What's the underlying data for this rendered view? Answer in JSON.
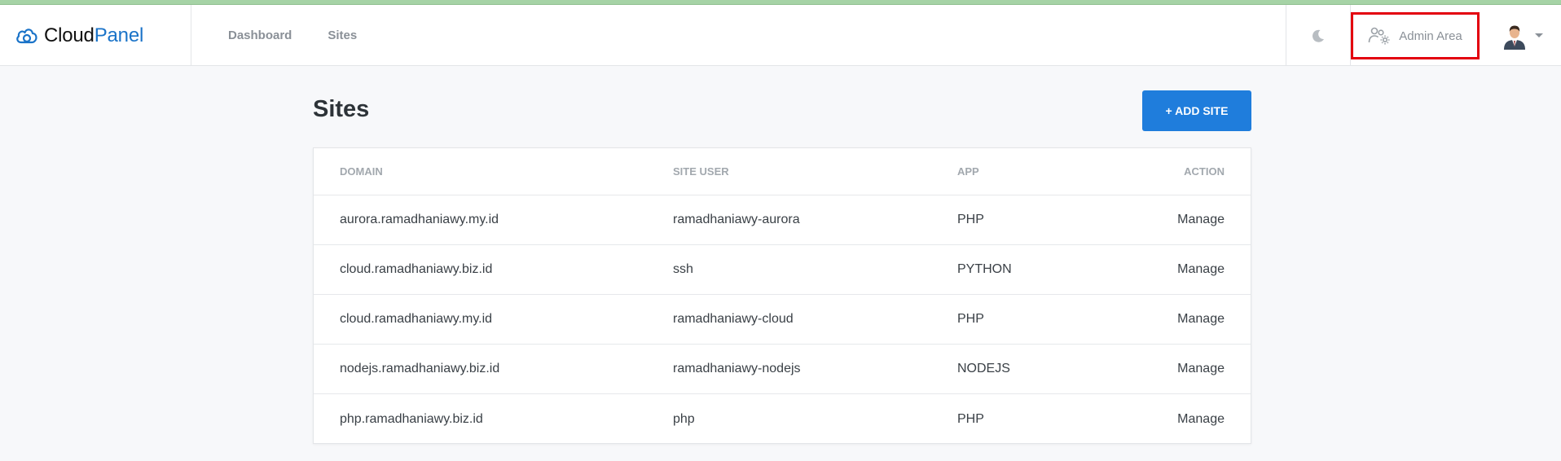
{
  "brand": {
    "name_part1": "Cloud",
    "name_part2": "Panel"
  },
  "nav": {
    "dashboard": "Dashboard",
    "sites": "Sites"
  },
  "header": {
    "admin_area": "Admin Area"
  },
  "icons": {
    "logo": "cloud-icon",
    "theme": "moon-icon",
    "admin": "users-cog-icon",
    "profile": "avatar",
    "dropdown": "caret-down-icon"
  },
  "page": {
    "title": "Sites",
    "add_button": "+ ADD SITE"
  },
  "table": {
    "headers": [
      "DOMAIN",
      "SITE USER",
      "APP",
      "ACTION"
    ],
    "rows": [
      {
        "domain": "aurora.ramadhaniawy.my.id",
        "user": "ramadhaniawy-aurora",
        "app": "PHP",
        "action": "Manage"
      },
      {
        "domain": "cloud.ramadhaniawy.biz.id",
        "user": "ssh",
        "app": "PYTHON",
        "action": "Manage"
      },
      {
        "domain": "cloud.ramadhaniawy.my.id",
        "user": "ramadhaniawy-cloud",
        "app": "PHP",
        "action": "Manage"
      },
      {
        "domain": "nodejs.ramadhaniawy.biz.id",
        "user": "ramadhaniawy-nodejs",
        "app": "NODEJS",
        "action": "Manage"
      },
      {
        "domain": "php.ramadhaniawy.biz.id",
        "user": "php",
        "app": "PHP",
        "action": "Manage"
      }
    ]
  },
  "colors": {
    "accent": "#1f7ddc",
    "brand_blue": "#1a73c8",
    "highlight_border": "#e3000f",
    "background": "#f7f8fa"
  }
}
